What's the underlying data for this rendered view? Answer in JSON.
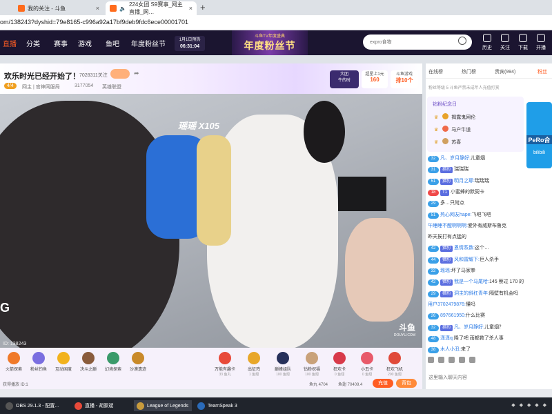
{
  "browser": {
    "tabs": [
      {
        "label": "我的关注 - 斗鱼",
        "active": false
      },
      {
        "label": "224女团 S9赛事_网主直播_网…",
        "active": true
      }
    ],
    "url": "om/138243?dyshid=79e8165-c996a92a17bf9deb9fdc6ece00001701"
  },
  "nav": {
    "items": [
      "直播",
      "分类",
      "赛事",
      "游戏",
      "鱼吧",
      "年度粉丝节"
    ],
    "countdown_label": "1月1日预热",
    "countdown_time": "06:31:04",
    "banner_top": "斗鱼TV年度盛典",
    "banner_main": "年度粉丝节",
    "search_placeholder": "expro食物",
    "icons": [
      "历史",
      "关注",
      "下载",
      "开播"
    ]
  },
  "room": {
    "title": "欢乐时光已经开始了！",
    "fans_count": "7028311关注",
    "level": "4/4",
    "host_label": "网主 | 官神网服局",
    "heat": "3177054",
    "category": "英雄联盟",
    "rank1_label": "超星上1元",
    "rank1_value": "160",
    "rank2_label": "斗鱼游戏",
    "rank2_value": "排10个",
    "badge_top": "大团",
    "badge_bottom": "牛的时"
  },
  "video": {
    "overlay_text": "瑶瑶 X105",
    "watermark": "斗鱼",
    "watermark_sub": "DOUYU.COM",
    "left_logo": "G",
    "viewer_id": "ID: 138243"
  },
  "gifts_left": [
    {
      "name": "火箭探索",
      "color": "#f07a2a"
    },
    {
      "name": "粉丝钓鱼",
      "color": "#7a6ee0"
    },
    {
      "name": "互动国度",
      "color": "#f2b21d"
    },
    {
      "name": "决斗之巅",
      "color": "#8a5c3c"
    },
    {
      "name": "幻境探索",
      "color": "#3a9a6a"
    },
    {
      "name": "沙漠遗迹",
      "color": "#c98a2a"
    }
  ],
  "gifts_right": [
    {
      "name": "万能有趣卡",
      "sub": "33 鱼丸",
      "color": "#e84a3a"
    },
    {
      "name": "出征鸡",
      "sub": "1 鱼翅",
      "color": "#e8a72a"
    },
    {
      "name": "巅峰组队",
      "sub": "100 鱼翅",
      "color": "#26305a"
    },
    {
      "name": "钻粉祝福",
      "sub": "100 鱼翅",
      "color": "#c9a27a"
    },
    {
      "name": "狂欢卡",
      "sub": "0 鱼翅",
      "color": "#d83a4a"
    },
    {
      "name": "小丑卡",
      "sub": "0 鱼翅",
      "color": "#e85a6a"
    },
    {
      "name": "狂欢飞机",
      "sub": "200 鱼翅",
      "color": "#e04a3a"
    }
  ],
  "feed": {
    "left_text": "获得播放 ID:1",
    "fishball": "鱼丸 4704",
    "fishfin": "鱼翅 70409.4",
    "charge_btn": "充值",
    "gift_btn": "背包"
  },
  "panel": {
    "tabs": [
      "在线榜",
      "热门榜",
      "贵宾(994)",
      "粉丝"
    ],
    "subline": "粉丝等级  5    斗鱼严禁未成年人充值打赏",
    "fan_header": "钻粉纪念日",
    "fans": [
      {
        "name": "揭露鬼网伦",
        "color": "#e8a22a"
      },
      {
        "name": "马户牛道",
        "color": "#f06a4a"
      },
      {
        "name": "苏喜",
        "color": "#d0a060"
      }
    ],
    "ad_text": "PeRo合",
    "ad_sub": "bilibili",
    "input_placeholder": "这里输入聊天内容"
  },
  "chat": [
    {
      "lv": "32",
      "lvc": "#3aa0e8",
      "badge": "",
      "name": "凡、岁月静好:",
      "text": "儿童烟"
    },
    {
      "lv": "31",
      "lvc": "#3aa0e8",
      "badge": "猎豹",
      "name": "",
      "text": "瑞瑞瑞"
    },
    {
      "lv": "51",
      "lvc": "#3aa0e8",
      "badge": "猎豹",
      "name": "明月之耶:",
      "text": "瑞瑞瑞"
    },
    {
      "lv": "18",
      "lvc": "#f04848",
      "badge": "T1",
      "name": "",
      "text": "小蜜蜂的默契卡"
    },
    {
      "lv": "29",
      "lvc": "#3aa0e8",
      "badge": "",
      "name": "",
      "text": "多…只附点"
    },
    {
      "lv": "51",
      "lvc": "#3aa0e8",
      "badge": "",
      "name": "热心网友hape:",
      "text": "飞吧飞吧"
    },
    {
      "lv": "",
      "lvc": "",
      "badge": "",
      "name": "午睡睡不醒啊啊啊:",
      "text": "爱外有威斯布鲁克"
    },
    {
      "lv": "",
      "lvc": "",
      "badge": "",
      "name": "",
      "text": "昨天挨打有点猛的"
    },
    {
      "lv": "42",
      "lvc": "#3aa0e8",
      "badge": "猎豹",
      "name": "恩情系数:",
      "text": "这个…"
    },
    {
      "lv": "44",
      "lvc": "#3aa0e8",
      "badge": "猎豹",
      "name": "风和雷耀下:",
      "text": "巨人杀手"
    },
    {
      "lv": "32",
      "lvc": "#3aa0e8",
      "badge": "",
      "name": "瑶瑶:",
      "text": "坏了马家拳"
    },
    {
      "lv": "42",
      "lvc": "#3aa0e8",
      "badge": "猎豹",
      "name": "我是一个马尾哈:",
      "text": "145 蔡过 170 的"
    },
    {
      "lv": "29",
      "lvc": "#3aa0e8",
      "badge": "猎豹",
      "name": "洞主的斜杠青年:",
      "text": "隔壁有机会吗"
    },
    {
      "lv": "",
      "lvc": "",
      "badge": "",
      "name": "用户3702479876:",
      "text": "懂吗"
    },
    {
      "lv": "26",
      "lvc": "#3aa0e8",
      "badge": "",
      "name": "897661950:",
      "text": "什么比赛"
    },
    {
      "lv": "32",
      "lvc": "#3aa0e8",
      "badge": "猎豹",
      "name": "凡、岁月静好:",
      "text": "儿童烟？"
    },
    {
      "lv": "48",
      "lvc": "#3aa0e8",
      "badge": "",
      "name": "潇潇q:",
      "text": "降了吧 雨都救了杀人事"
    },
    {
      "lv": "38",
      "lvc": "#3aa0e8",
      "badge": "",
      "name": "木人小丑:",
      "text": "来了"
    }
  ],
  "taskbar": {
    "items": [
      {
        "label": "OBS 29.1.3 - 配置...",
        "color": "#3a3f4a"
      },
      {
        "label": "直播 - 胡家斌",
        "color": "#e84a3a"
      },
      {
        "label": "League of Legends",
        "color": "#c89b3c"
      },
      {
        "label": "TeamSpeak 3",
        "color": "#2a6ab8"
      }
    ]
  }
}
